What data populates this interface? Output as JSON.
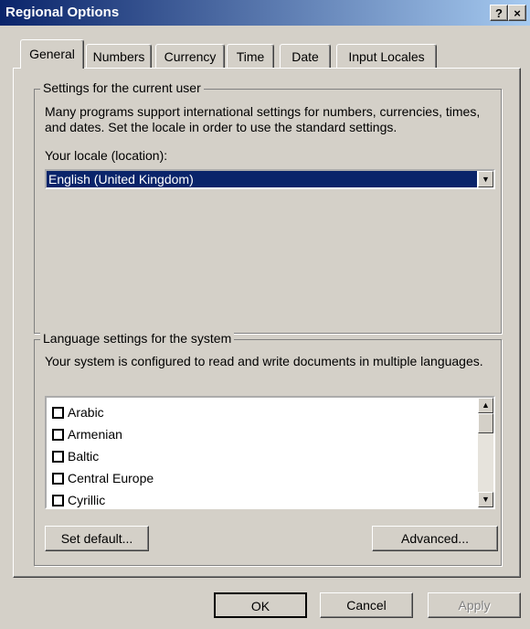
{
  "window": {
    "title": "Regional Options",
    "help_label": "?",
    "close_label": "×"
  },
  "tabs": [
    {
      "label": "General",
      "active": true
    },
    {
      "label": "Numbers"
    },
    {
      "label": "Currency"
    },
    {
      "label": "Time"
    },
    {
      "label": "Date"
    },
    {
      "label": "Input Locales"
    }
  ],
  "current_user": {
    "legend": "Settings for the current user",
    "description": "Many programs support international settings for numbers, currencies, times, and dates. Set the locale in order to use the standard settings.",
    "locale_label": "Your locale (location):",
    "locale_value": "English (United Kingdom)"
  },
  "system_language": {
    "legend": "Language settings for the system",
    "description": "Your system is configured to read and write documents in multiple languages.",
    "items": [
      {
        "label": "Arabic",
        "checked": false
      },
      {
        "label": "Armenian",
        "checked": false
      },
      {
        "label": "Baltic",
        "checked": false
      },
      {
        "label": "Central Europe",
        "checked": false
      },
      {
        "label": "Cyrillic",
        "checked": false
      }
    ],
    "set_default_label": "Set default...",
    "advanced_label": "Advanced..."
  },
  "footer": {
    "ok_label": "OK",
    "cancel_label": "Cancel",
    "apply_label": "Apply"
  },
  "icons": {
    "combo_arrow": "dropdown-arrow-icon",
    "scroll_up": "scroll-up-icon",
    "scroll_down": "scroll-down-icon"
  },
  "colors": {
    "titlebar": "#0a246a",
    "selection": "#0a246a",
    "face": "#d4d0c8"
  }
}
